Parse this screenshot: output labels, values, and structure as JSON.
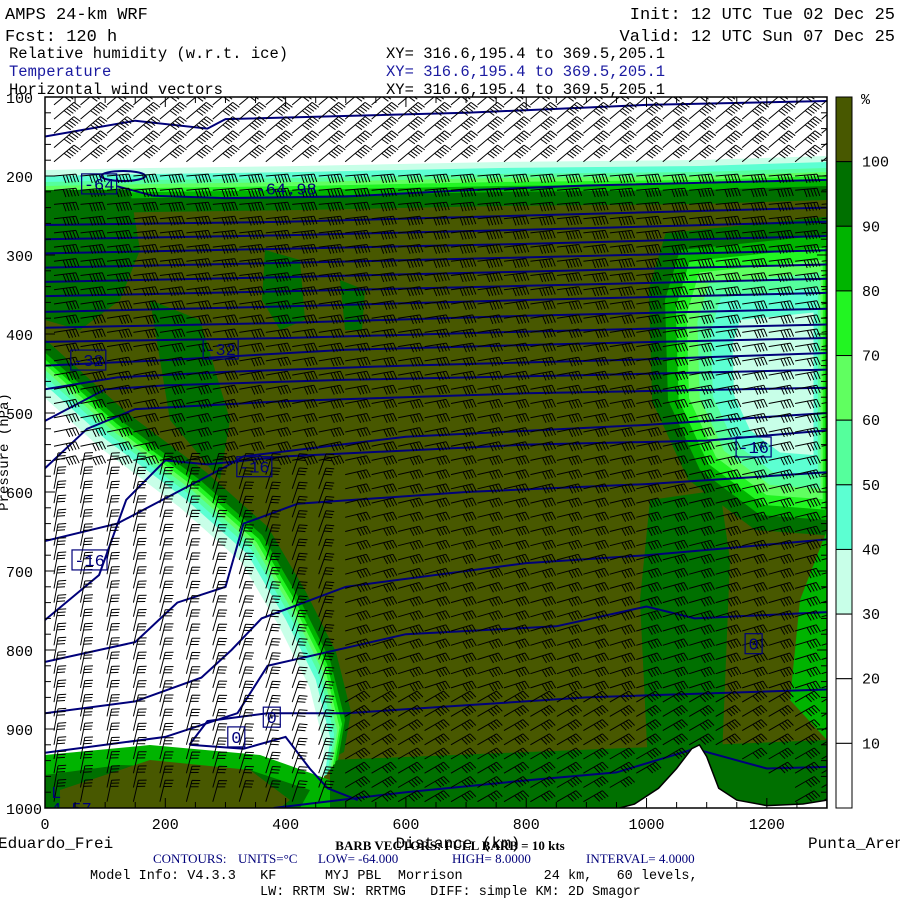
{
  "header": {
    "title": "AMPS 24-km WRF",
    "forecast": "Fcst: 120 h",
    "init": "Init: 12 UTC Tue 02 Dec 25",
    "valid": "Valid: 12 UTC Sun 07 Dec 25",
    "fields": [
      {
        "name": "Relative humidity (w.r.t. ice)",
        "xy": "XY= 316.6,195.4 to 369.5,205.1",
        "color": "#000000"
      },
      {
        "name": "Temperature",
        "xy": "XY= 316.6,195.4 to 369.5,205.1",
        "color": "#1a1aa0"
      },
      {
        "name": "Horizontal wind vectors",
        "xy": "XY= 316.6,195.4 to 369.5,205.1",
        "color": "#000000"
      }
    ]
  },
  "footer": {
    "left_station": "Eduardo_Frei",
    "right_station": "Punta_Aren",
    "barb_note": "BARB VECTORS: FULL BARB = 10 kts",
    "contours": {
      "label": "CONTOURS:",
      "units": "UNITS=°C",
      "low": "LOW= -64.000",
      "high": "HIGH= 8.0000",
      "interval": "INTERVAL= 4.0000"
    },
    "model_info": "Model Info: V4.3.3   KF      MYJ PBL  Morrison          24 km,   60 levels,",
    "physics": "LW: RRTM SW: RRTMG   DIFF: simple KM: 2D Smagor"
  },
  "chart_data": {
    "type": "heatmap",
    "title": "Relative humidity (w.r.t. ice) / Temperature / Horizontal wind vectors",
    "xlabel": "Distance (km)",
    "ylabel": "Pressure (hPa)",
    "xlim": [
      0,
      1300
    ],
    "ylim": [
      100,
      1000
    ],
    "x_ticks": [
      0,
      200,
      400,
      600,
      800,
      1000,
      1200
    ],
    "y_ticks": [
      100,
      200,
      300,
      400,
      500,
      600,
      700,
      800,
      900,
      1000
    ],
    "colorbar": {
      "unit": "%",
      "labels": [
        "100",
        "90",
        "80",
        "70",
        "60",
        "50",
        "40",
        "30",
        "20",
        "10"
      ],
      "bins": [
        {
          "range": ">100",
          "color": "#485800"
        },
        {
          "range": "90-100",
          "color": "#007000"
        },
        {
          "range": "80-90",
          "color": "#00b400"
        },
        {
          "range": "70-80",
          "color": "#22f522"
        },
        {
          "range": "60-70",
          "color": "#60ff60"
        },
        {
          "range": "50-60",
          "color": "#55ff9c"
        },
        {
          "range": "40-50",
          "color": "#5cffd2"
        },
        {
          "range": "30-40",
          "color": "#c8ffe8"
        },
        {
          "range": "20-30",
          "color": "#ffffff"
        },
        {
          "range": "10-20",
          "color": "#ffffff"
        },
        {
          "range": "0-10",
          "color": "#ffffff"
        }
      ]
    },
    "contour_color": "#00007a",
    "contour_labels": [
      {
        "text": "-64",
        "km": 90,
        "hPa": 210,
        "boxed": true
      },
      {
        "text": "-64.98",
        "km": 350,
        "hPa": 216,
        "boxed": false
      },
      {
        "text": "-32",
        "km": 72,
        "hPa": 433,
        "boxed": true
      },
      {
        "text": "-32",
        "km": 292,
        "hPa": 419,
        "boxed": true
      },
      {
        "text": "-16",
        "km": 348,
        "hPa": 568,
        "boxed": true
      },
      {
        "text": "-16",
        "km": 1178,
        "hPa": 543,
        "boxed": true
      },
      {
        "text": "-16",
        "km": 74,
        "hPa": 686,
        "boxed": true
      },
      {
        "text": "0",
        "km": 377,
        "hPa": 885,
        "boxed": true
      },
      {
        "text": "0",
        "km": 318,
        "hPa": 910,
        "boxed": true
      },
      {
        "text": "0",
        "km": 1178,
        "hPa": 792,
        "boxed": true
      },
      {
        "text": "L",
        "km": 10,
        "hPa": 980,
        "boxed": false
      },
      {
        "text": "4.57",
        "km": 10,
        "hPa": 1000,
        "boxed": false
      }
    ],
    "temperature_contours": [
      [
        [
          0,
          150
        ],
        [
          150,
          130
        ],
        [
          270,
          140
        ],
        [
          300,
          128
        ],
        [
          700,
          120
        ],
        [
          1000,
          110
        ],
        [
          1300,
          105
        ]
      ],
      [
        [
          120,
          213
        ],
        [
          180,
          225
        ],
        [
          300,
          228
        ],
        [
          500,
          226
        ],
        [
          700,
          218
        ],
        [
          900,
          212
        ],
        [
          1300,
          205
        ]
      ],
      [
        [
          0,
          262
        ],
        [
          400,
          258
        ],
        [
          800,
          250
        ],
        [
          1300,
          240
        ]
      ],
      [
        [
          0,
          280
        ],
        [
          400,
          275
        ],
        [
          800,
          268
        ],
        [
          1300,
          258
        ]
      ],
      [
        [
          0,
          298
        ],
        [
          400,
          292
        ],
        [
          800,
          286
        ],
        [
          1300,
          276
        ]
      ],
      [
        [
          0,
          316
        ],
        [
          400,
          310
        ],
        [
          800,
          303
        ],
        [
          1300,
          294
        ]
      ],
      [
        [
          0,
          334
        ],
        [
          400,
          328
        ],
        [
          800,
          321
        ],
        [
          1300,
          312
        ]
      ],
      [
        [
          0,
          352
        ],
        [
          400,
          346
        ],
        [
          800,
          339
        ],
        [
          1300,
          330
        ]
      ],
      [
        [
          0,
          372
        ],
        [
          400,
          365
        ],
        [
          800,
          357
        ],
        [
          1300,
          348
        ]
      ],
      [
        [
          0,
          392
        ],
        [
          400,
          386
        ],
        [
          800,
          377
        ],
        [
          1300,
          368
        ]
      ],
      [
        [
          0,
          410
        ],
        [
          400,
          405
        ],
        [
          800,
          397
        ],
        [
          1300,
          388
        ]
      ],
      [
        [
          0,
          440
        ],
        [
          200,
          433
        ],
        [
          500,
          420
        ],
        [
          900,
          412
        ],
        [
          1300,
          405
        ]
      ],
      [
        [
          0,
          470
        ],
        [
          120,
          455
        ],
        [
          300,
          448
        ],
        [
          600,
          440
        ],
        [
          1000,
          432
        ],
        [
          1300,
          424
        ]
      ],
      [
        [
          0,
          510
        ],
        [
          100,
          470
        ],
        [
          200,
          465
        ],
        [
          500,
          458
        ],
        [
          900,
          452
        ],
        [
          1300,
          445
        ]
      ],
      [
        [
          0,
          570
        ],
        [
          70,
          520
        ],
        [
          150,
          495
        ],
        [
          400,
          485
        ],
        [
          800,
          475
        ],
        [
          1300,
          468
        ]
      ],
      [
        [
          0,
          662
        ],
        [
          120,
          640
        ],
        [
          300,
          568
        ],
        [
          330,
          555
        ],
        [
          600,
          530
        ],
        [
          1000,
          515
        ],
        [
          1300,
          500
        ]
      ],
      [
        [
          0,
          762
        ],
        [
          90,
          705
        ],
        [
          135,
          610
        ],
        [
          200,
          560
        ],
        [
          270,
          565
        ],
        [
          400,
          555
        ],
        [
          800,
          540
        ],
        [
          1100,
          535
        ],
        [
          1300,
          522
        ]
      ],
      [
        [
          0,
          815
        ],
        [
          150,
          790
        ],
        [
          220,
          740
        ],
        [
          300,
          720
        ],
        [
          330,
          640
        ],
        [
          420,
          615
        ],
        [
          700,
          600
        ],
        [
          1000,
          590
        ],
        [
          1300,
          575
        ]
      ],
      [
        [
          0,
          880
        ],
        [
          150,
          865
        ],
        [
          260,
          835
        ],
        [
          310,
          800
        ],
        [
          360,
          760
        ],
        [
          500,
          720
        ],
        [
          800,
          690
        ],
        [
          1000,
          680
        ],
        [
          1300,
          660
        ]
      ],
      [
        [
          0,
          930
        ],
        [
          200,
          910
        ],
        [
          320,
          880
        ],
        [
          370,
          820
        ],
        [
          600,
          780
        ],
        [
          850,
          770
        ],
        [
          1000,
          745
        ],
        [
          1080,
          760
        ],
        [
          1300,
          752
        ]
      ],
      [
        [
          240,
          920
        ],
        [
          270,
          890
        ],
        [
          370,
          880
        ],
        [
          500,
          880
        ],
        [
          700,
          870
        ],
        [
          900,
          860
        ],
        [
          1300,
          850
        ]
      ],
      [
        [
          240,
          920
        ],
        [
          330,
          925
        ],
        [
          400,
          910
        ],
        [
          440,
          950
        ],
        [
          470,
          975
        ],
        [
          520,
          990
        ]
      ],
      [
        [
          380,
          1000
        ],
        [
          600,
          980
        ],
        [
          800,
          965
        ],
        [
          950,
          955
        ],
        [
          1080,
          925
        ],
        [
          1200,
          950
        ],
        [
          1300,
          948
        ]
      ]
    ]
  }
}
